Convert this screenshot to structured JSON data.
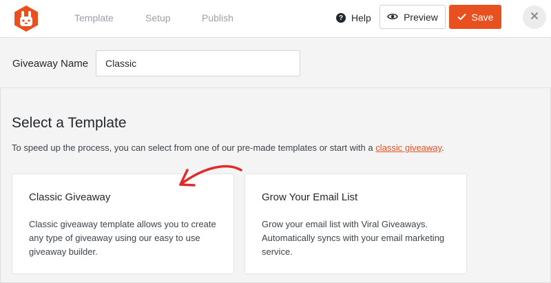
{
  "topbar": {
    "tabs": [
      "Template",
      "Setup",
      "Publish"
    ],
    "help_label": "Help",
    "preview_label": "Preview",
    "save_label": "Save",
    "logo_icon": "rabbit-logo-icon",
    "accent_color": "#e8501f"
  },
  "giveaway": {
    "name_label": "Giveaway Name",
    "name_value": "Classic"
  },
  "main": {
    "title": "Select a Template",
    "intro_text": "To speed up the process, you can select from one of our pre-made templates or start with a ",
    "intro_link": "classic giveaway",
    "intro_end": ".",
    "templates": [
      {
        "title": "Classic Giveaway",
        "description": "Classic giveaway template allows you to create any type of giveaway using our easy to use giveaway builder."
      },
      {
        "title": "Grow Your Email List",
        "description": "Grow your email list with Viral Giveaways. Automatically syncs with your email marketing service."
      }
    ]
  }
}
